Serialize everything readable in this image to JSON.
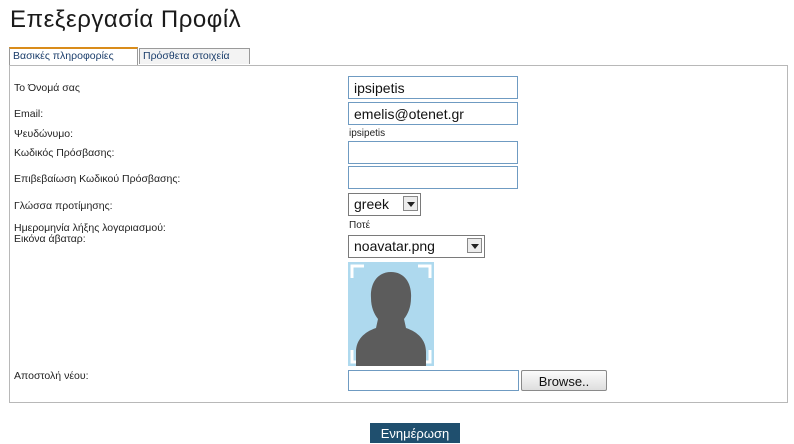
{
  "page": {
    "title": "Επεξεργασία Προφίλ"
  },
  "tabs": [
    {
      "label": "Βασικές πληροφορίες",
      "active": true
    },
    {
      "label": "Πρόσθετα στοιχεία",
      "active": false
    }
  ],
  "form": {
    "name": {
      "label": "Το Όνομά σας",
      "value": "ipsipetis"
    },
    "email": {
      "label": "Email:",
      "value": "emelis@otenet.gr"
    },
    "nickname": {
      "label": "Ψευδώνυμο:",
      "value": "ipsipetis"
    },
    "password": {
      "label": "Κωδικός Πρόσβασης:",
      "value": ""
    },
    "password_confirm": {
      "label": "Επιβεβαίωση Κωδικού Πρόσβασης:",
      "value": ""
    },
    "language": {
      "label": "Γλώσσα προτίμησης:",
      "selected": "greek"
    },
    "expiry": {
      "label": "Ημερομηνία λήξης λογαριασμού:",
      "value": "Ποτέ"
    },
    "avatar": {
      "label": "Εικόνα άβαταρ:",
      "selected": "noavatar.png"
    },
    "upload": {
      "label": "Αποστολή νέου:",
      "value": "",
      "browse_label": "Browse.."
    }
  },
  "actions": {
    "submit_label": "Ενημέρωση"
  },
  "colors": {
    "active_tab_accent": "#d98c1a",
    "input_border": "#6f9bc2",
    "avatar_bg": "#aed9ee",
    "avatar_silhouette": "#5c5c5c",
    "submit_bg": "#1f4f6e"
  },
  "icons": {
    "avatar_placeholder": "person-silhouette-icon",
    "select_arrow": "chevron-down-icon"
  }
}
